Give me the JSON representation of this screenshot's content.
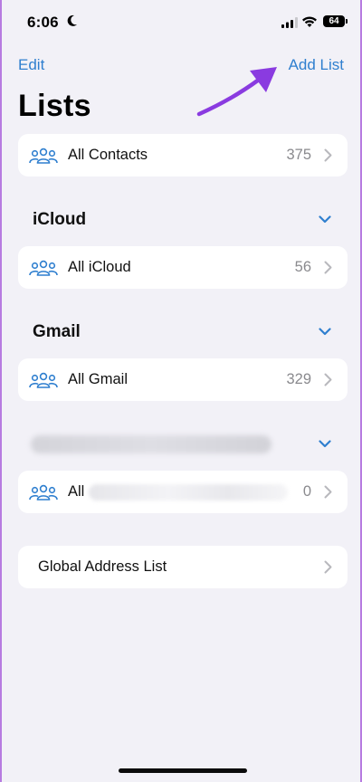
{
  "status": {
    "time": "6:06",
    "battery": "64"
  },
  "nav": {
    "edit_label": "Edit",
    "add_label": "Add List"
  },
  "page": {
    "title": "Lists"
  },
  "rows": {
    "all_contacts": {
      "label": "All Contacts",
      "count": "375"
    },
    "all_icloud": {
      "label": "All iCloud",
      "count": "56"
    },
    "all_gmail": {
      "label": "All Gmail",
      "count": "329"
    },
    "all_other": {
      "label": "All",
      "count": "0"
    },
    "global": {
      "label": "Global Address List"
    }
  },
  "sections": {
    "icloud": "iCloud",
    "gmail": "Gmail"
  },
  "icons": {
    "accent": "#2f7fcf",
    "annotation_arrow": "#8a3be0"
  }
}
